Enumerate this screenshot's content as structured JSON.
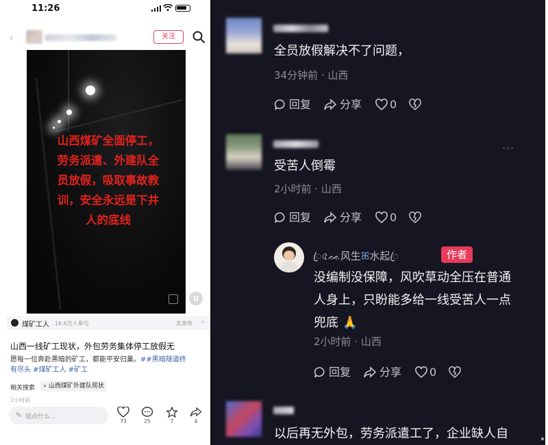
{
  "status_bar": {
    "time": "11:26"
  },
  "header": {
    "follow_label": "关注",
    "search_icon": "search-icon"
  },
  "video": {
    "caption_lines": [
      "山西煤矿全面停工，",
      "劳务派遣、外建队全",
      "员放假，吸取事故教",
      "训，安全永远是下井",
      "人的底线"
    ]
  },
  "post": {
    "tag": "煤矿工人",
    "participants": "16.6万人参与",
    "publish": "去发布",
    "title": "山西一线矿工现状，外包劳务集体停工放假无",
    "desc_text": "愿每一位奔赴黑暗的矿工，都能平安归巢。",
    "hashtags_line1": "##黑暗隧道终",
    "hashtags_line2": "有尽头 #煤矿工人 #矿工",
    "related_label": "相关搜索",
    "related_query": "山西煤矿外建队现状",
    "time": "2小时前"
  },
  "bottom_bar": {
    "input_placeholder": "说点什么...",
    "likes": "73",
    "comments": "25",
    "favorites": "7",
    "shares": "4"
  },
  "comments": [
    {
      "text": "全员放假解决不了问题，",
      "meta": "34分钟前 · 山西",
      "reply": "回复",
      "share": "分享",
      "likes": "0"
    },
    {
      "text": "受苦人倒霉",
      "meta": "2小时前 · 山西",
      "reply": "回复",
      "share": "分享",
      "likes": "0"
    },
    {
      "text": "以后再无外包，劳务派遣工了，企业缺人自"
    }
  ],
  "reply": {
    "name_prefix": "ꦿ৫ᨐ风生",
    "name_suffix": "水起ꦿ",
    "badge": "作者",
    "lines": [
      "没编制没保障，风吹草动全压在普通",
      "人身上，只盼能多给一线受苦人一点",
      "兜底 🙏"
    ],
    "meta": "2小时前 · 山西",
    "reply_label": "回复",
    "share_label": "分享",
    "likes": "0"
  },
  "colors": {
    "dark_bg": "#161622",
    "accent_red": "#e83a5a",
    "caption_red": "#e2211c",
    "hashtag_blue": "#3d61a8"
  }
}
